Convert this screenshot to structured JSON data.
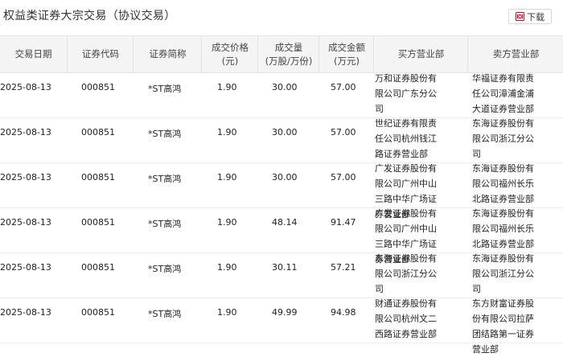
{
  "header": {
    "title": "权益类证券大宗交易（协议交易）",
    "download_label": "下载"
  },
  "columns": [
    {
      "label": "交易日期"
    },
    {
      "label": "证券代码"
    },
    {
      "label": "证券简称"
    },
    {
      "label": "成交价格",
      "sub": "(元)"
    },
    {
      "label": "成交量",
      "sub": "(万股/万份)"
    },
    {
      "label": "成交金额",
      "sub": "(万元)"
    },
    {
      "label": "买方营业部"
    },
    {
      "label": "卖方营业部"
    }
  ],
  "rows": [
    {
      "date": "2025-08-13",
      "code": "000851",
      "name": "*ST高鸿",
      "price": "1.90",
      "volume": "30.00",
      "amount": "57.00",
      "buyer": "万和证券股份有限公司广东分公司",
      "seller": "华福证券有限责任公司漳浦金浦大道证券营业部"
    },
    {
      "date": "2025-08-13",
      "code": "000851",
      "name": "*ST高鸿",
      "price": "1.90",
      "volume": "30.00",
      "amount": "57.00",
      "buyer": "世纪证券有限责任公司杭州钱江路证券营业部",
      "seller": "东海证券股份有限公司浙江分公司"
    },
    {
      "date": "2025-08-13",
      "code": "000851",
      "name": "*ST高鸿",
      "price": "1.90",
      "volume": "30.00",
      "amount": "57.00",
      "buyer": "广发证券股份有限公司广州中山三路中华广场证券营业部",
      "seller": "东海证券股份有限公司福州长乐北路证券营业部"
    },
    {
      "date": "2025-08-13",
      "code": "000851",
      "name": "*ST高鸿",
      "price": "1.90",
      "volume": "48.14",
      "amount": "91.47",
      "buyer": "广发证券股份有限公司广州中山三路中华广场证券营业部",
      "seller": "东海证券股份有限公司福州长乐北路证券营业部"
    },
    {
      "date": "2025-08-13",
      "code": "000851",
      "name": "*ST高鸿",
      "price": "1.90",
      "volume": "30.11",
      "amount": "57.21",
      "buyer": "东海证券股份有限公司浙江分公司",
      "seller": "东海证券股份有限公司浙江分公司"
    },
    {
      "date": "2025-08-13",
      "code": "000851",
      "name": "*ST高鸿",
      "price": "1.90",
      "volume": "49.99",
      "amount": "94.98",
      "buyer": "财通证券股份有限公司杭州文二西路证券营业部",
      "seller": "东方财富证券股份有限公司拉萨团结路第一证券营业部"
    }
  ],
  "icons": {
    "download": "excel-download-icon",
    "accent": "#c8102e"
  }
}
